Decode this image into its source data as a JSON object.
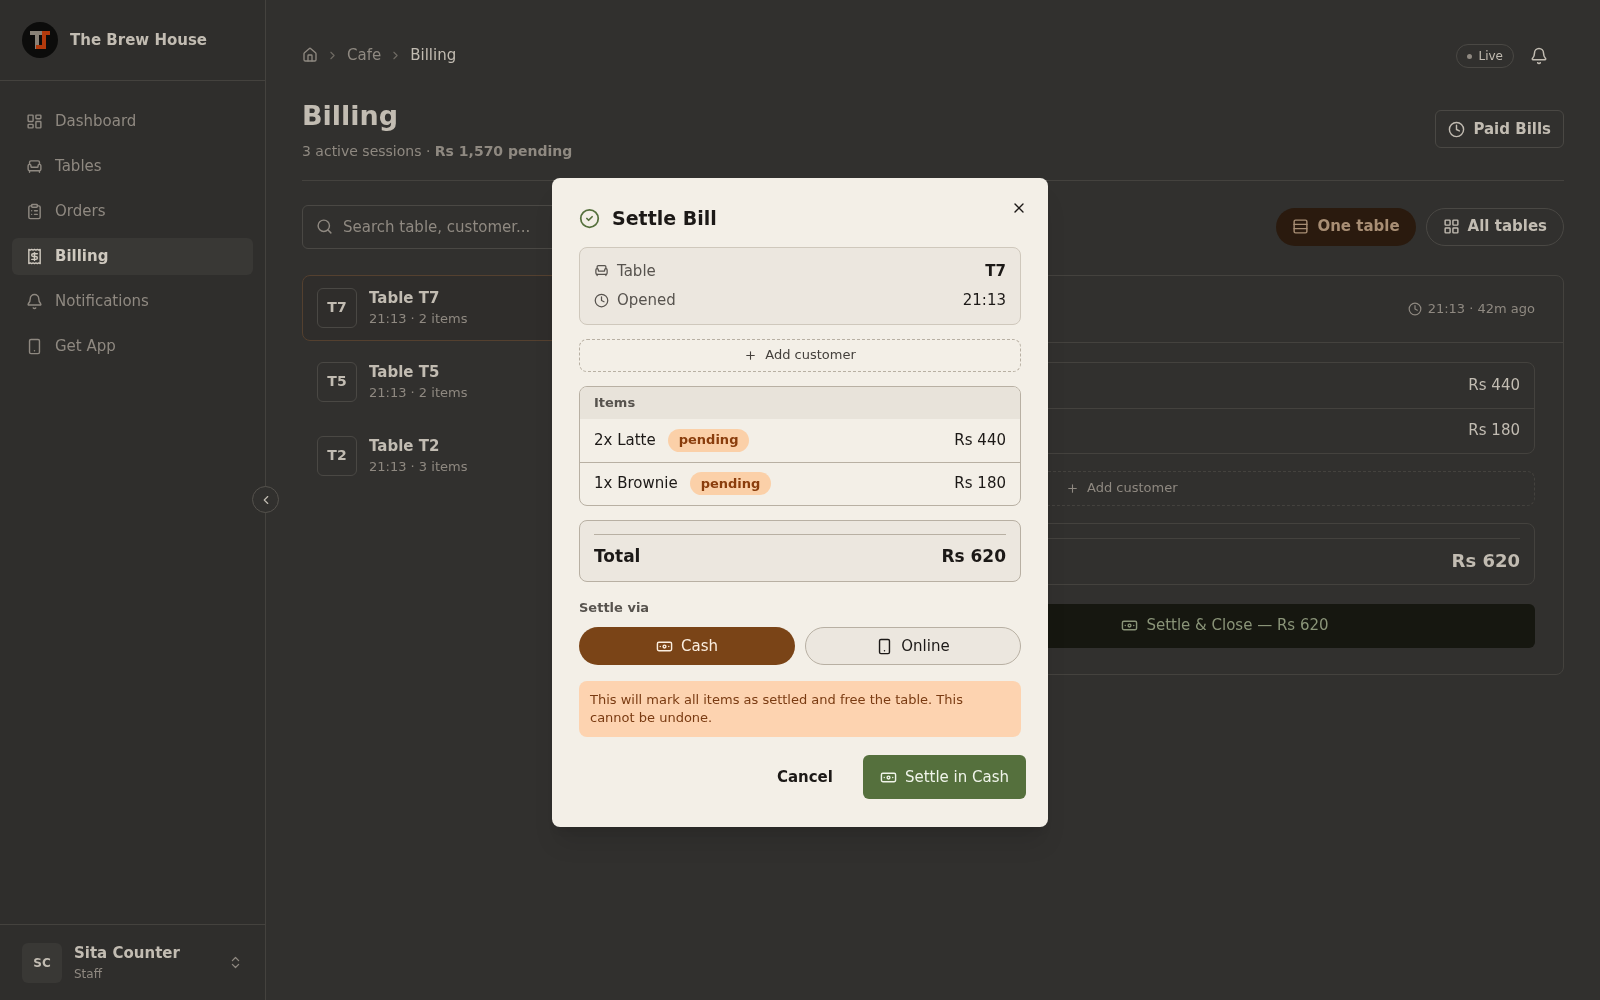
{
  "sidebar": {
    "brand": "The Brew House",
    "items": [
      {
        "label": "Dashboard",
        "kind": "dashboard",
        "selected": false
      },
      {
        "label": "Tables",
        "kind": "tables",
        "selected": false
      },
      {
        "label": "Orders",
        "kind": "orders",
        "selected": false
      },
      {
        "label": "Billing",
        "kind": "billing",
        "selected": true
      },
      {
        "label": "Notifications",
        "kind": "notifications",
        "selected": false
      },
      {
        "label": "Get App",
        "kind": "app",
        "selected": false
      }
    ],
    "user": {
      "initials": "SC",
      "name": "Sita Counter",
      "role": "Staff"
    }
  },
  "header": {
    "breadcrumb": [
      "Cafe",
      "Billing"
    ],
    "live": "Live"
  },
  "page": {
    "title": "Billing",
    "subtitle": "3 active sessions · **Rs 1,570 pending**",
    "paid_bills": "Paid Bills"
  },
  "search": {
    "placeholder": "Search table, customer..."
  },
  "view_toggle": [
    {
      "label": "One table",
      "kind": "rows",
      "selected": true
    },
    {
      "label": "All tables",
      "kind": "grid",
      "selected": false
    }
  ],
  "sessions": [
    {
      "code": "T7",
      "name": "Table T7",
      "meta": "21:13 · 2 items",
      "selected": true
    },
    {
      "code": "T5",
      "name": "Table T5",
      "meta": "21:13 · 2 items",
      "selected": false
    },
    {
      "code": "T2",
      "name": "Table T2",
      "meta": "21:13 · 3 items",
      "selected": false
    }
  ],
  "session_detail": {
    "opened": "21:13 · 42m ago",
    "lines": [
      "Rs 440",
      "Rs 180"
    ],
    "add_customer": "Add customer",
    "total": "Rs 620",
    "settle_button": "Settle & Close — Rs 620"
  },
  "dialog": {
    "title": "Settle Bill",
    "summary": [
      {
        "label": "Table",
        "value": "T7",
        "kind": "table"
      },
      {
        "label": "Opened",
        "value": "21:13",
        "kind": "time"
      }
    ],
    "add_customer": "Add customer",
    "items_heading": "Items",
    "items": [
      {
        "name": "2x Latte",
        "status": "pending",
        "price": "Rs 440"
      },
      {
        "name": "1x Brownie",
        "status": "pending",
        "price": "Rs 180"
      }
    ],
    "total_label": "Total",
    "total": "Rs 620",
    "settle_via": "Settle via",
    "methods": [
      {
        "label": "Cash",
        "kind": "cash",
        "selected": true
      },
      {
        "label": "Online",
        "kind": "online",
        "selected": false
      }
    ],
    "warning": "This will mark all items as settled and free the table. This cannot be undone.",
    "cancel": "Cancel",
    "confirm": "Settle in Cash"
  }
}
